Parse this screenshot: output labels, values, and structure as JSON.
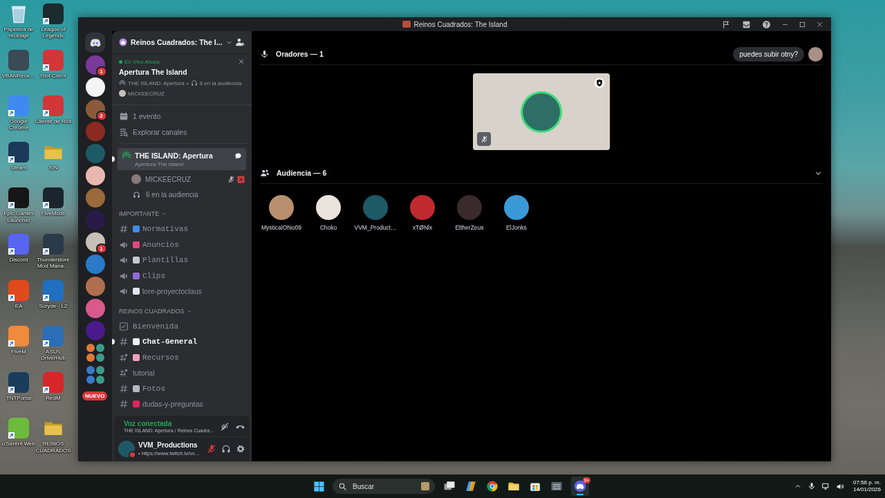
{
  "desktop": {
    "icons": [
      {
        "label": "Papelera de reciclaje",
        "kind": "bin",
        "color": "#a9cfe0",
        "shortcut": false
      },
      {
        "label": "League of Legends",
        "kind": "app",
        "color": "#1b2b2f",
        "shortcut": true
      },
      {
        "label": "VBANRece…",
        "kind": "app",
        "color": "#3b4a55",
        "shortcut": false
      },
      {
        "label": "Riot Client",
        "kind": "app",
        "color": "#d13639",
        "shortcut": true
      },
      {
        "label": "Google Chrome",
        "kind": "app",
        "color": "#3f8af0",
        "shortcut": true
      },
      {
        "label": "Cliente de Riot",
        "kind": "app",
        "color": "#d13639",
        "shortcut": true
      },
      {
        "label": "Steam",
        "kind": "app",
        "color": "#1b3a5a",
        "shortcut": true
      },
      {
        "label": "XIN",
        "kind": "folder",
        "color": "#e8c24a",
        "shortcut": false
      },
      {
        "label": "Epic Games Launcher",
        "kind": "app",
        "color": "#161616",
        "shortcut": true
      },
      {
        "label": "FiveMods",
        "kind": "app",
        "color": "#1c2430",
        "shortcut": true
      },
      {
        "label": "Discord",
        "kind": "app",
        "color": "#5865f2",
        "shortcut": true
      },
      {
        "label": "Thunderstore Mod Mana…",
        "kind": "app",
        "color": "#2b3a4a",
        "shortcut": true
      },
      {
        "label": "EA",
        "kind": "app",
        "color": "#e04a1c",
        "shortcut": true
      },
      {
        "label": "Scryde - L2",
        "kind": "app",
        "color": "#1f6fc2",
        "shortcut": true
      },
      {
        "label": "FiveM",
        "kind": "app",
        "color": "#f08a3c",
        "shortcut": true
      },
      {
        "label": "ASUS DriverHub",
        "kind": "app",
        "color": "#2a6fb5",
        "shortcut": true
      },
      {
        "label": "TNTPortal",
        "kind": "app",
        "color": "#1a3d5c",
        "shortcut": true
      },
      {
        "label": "RedM",
        "kind": "app",
        "color": "#d6262a",
        "shortcut": true
      },
      {
        "label": "uTorrent Web",
        "kind": "app",
        "color": "#6dbb3d",
        "shortcut": true
      },
      {
        "label": "REINOS CUADRADOS",
        "kind": "folder",
        "color": "#e8c24a",
        "shortcut": false
      }
    ]
  },
  "window": {
    "title": "Reinos Cuadrados: The Island"
  },
  "servers": [
    {
      "kind": "server",
      "color": "#7a3a9a",
      "badge": "1"
    },
    {
      "kind": "server",
      "color": "#f4f4f4"
    },
    {
      "kind": "server",
      "color": "#8a5a3a",
      "badge": "2"
    },
    {
      "kind": "server",
      "color": "#8a2a20"
    },
    {
      "kind": "server",
      "color": "#1d5a66"
    },
    {
      "kind": "server",
      "color": "#e8b8b0"
    },
    {
      "kind": "server",
      "color": "#9a6a3a"
    },
    {
      "kind": "server",
      "color": "#2a1a4a"
    },
    {
      "kind": "server",
      "color": "#c8c0b8",
      "badge": "1"
    },
    {
      "kind": "server",
      "color": "#2a7ac8"
    },
    {
      "kind": "server",
      "color": "#b07050"
    },
    {
      "kind": "server",
      "color": "#d85a8a"
    },
    {
      "kind": "server",
      "color": "#4a1a8a"
    },
    {
      "kind": "folder",
      "color": "#e07a3a"
    },
    {
      "kind": "folder",
      "color": "#3a7ac8"
    }
  ],
  "new_badge": "NUEVO",
  "sidebar": {
    "header": {
      "title": "Reinos Cuadrados: The I..."
    },
    "live": {
      "status": "En Vivo Ahora",
      "title": "Apertura The Island",
      "channel": "THE ISLAND: Apertura",
      "separator": "•",
      "audience": "6 en la audiencia",
      "host": "MICKEECRUZ"
    },
    "links": [
      {
        "label": "1 evento",
        "kind": "events"
      },
      {
        "label": "Explorar canales",
        "kind": "browse"
      }
    ],
    "stage": {
      "name": "THE ISLAND: Apertura",
      "topic": "Apertura The Island",
      "selected": true,
      "unread": true,
      "members": [
        {
          "name": "MICKEECRUZ",
          "muted": true
        }
      ],
      "audience": "6 en la audiencia"
    },
    "categories": [
      {
        "name": "IMPORTANTE",
        "expanded": true,
        "channels": [
          {
            "name": "Normativas",
            "kind": "text",
            "color": "#3b8ee8",
            "mono": true,
            "unread": false
          },
          {
            "name": "Anuncios",
            "kind": "announcement",
            "color": "#e8457a",
            "mono": true,
            "unread": false
          },
          {
            "name": "Plantillas",
            "kind": "announcement",
            "color": "#c8c8d0",
            "mono": true,
            "unread": false
          },
          {
            "name": "Clips",
            "kind": "announcement",
            "color": "#8e6ad8",
            "mono": true,
            "unread": false
          },
          {
            "name": "lore-proyectoclaus",
            "kind": "announcement",
            "color": "#dfe6f0",
            "mono": false,
            "unread": false
          }
        ]
      },
      {
        "name": "REINOS CUADRADOS",
        "expanded": true,
        "channels": [
          {
            "name": "Bienvenida",
            "kind": "rules",
            "mono": true,
            "unread": false
          },
          {
            "name": "Chat-General",
            "kind": "text",
            "color": "#f0f0f0",
            "mono": true,
            "unread": true
          },
          {
            "name": "Recursos",
            "kind": "threads",
            "color": "#f0a0b8",
            "mono": true,
            "unread": false
          },
          {
            "name": "tutorial",
            "kind": "threads",
            "mono": false,
            "unread": false
          },
          {
            "name": "Fotos",
            "kind": "text",
            "color": "#b8b8c0",
            "mono": true,
            "unread": false
          },
          {
            "name": "dudas-y-preguntas",
            "kind": "text",
            "color": "#e0245e",
            "mono": false,
            "unread": false
          }
        ]
      }
    ],
    "voice": {
      "status": "Voz conectada",
      "channel": "THE ISLAND: Apertura / Reinos Cuadra…"
    },
    "user": {
      "name": "VVM_Productions",
      "status": "• https://www.twitch.tv/vv…",
      "muted": true
    }
  },
  "stage_view": {
    "speakers_title": "Oradores — 1",
    "request": "puedes subir otny?",
    "speakers": [
      {
        "muted": true,
        "moderator": true
      }
    ],
    "audience_title": "Audiencia — 6",
    "audience_expanded": true,
    "audience": [
      {
        "name": "MysticalOhio09",
        "color": "#b89070"
      },
      {
        "name": "Choko",
        "color": "#e8e4dc"
      },
      {
        "name": "VVM_Product…",
        "color": "#1d5a66"
      },
      {
        "name": "xTØNlx",
        "color": "#c02a30"
      },
      {
        "name": "EltherZeus",
        "color": "#3a2a2e"
      },
      {
        "name": "ElJonks",
        "color": "#3a9ad8"
      }
    ]
  },
  "taskbar": {
    "search": "Buscar",
    "apps": [
      {
        "kind": "task-view",
        "active": false
      },
      {
        "kind": "copilot",
        "active": false
      },
      {
        "kind": "chrome",
        "active": false
      },
      {
        "kind": "files",
        "active": false
      },
      {
        "kind": "store",
        "active": false
      },
      {
        "kind": "vban",
        "active": false
      },
      {
        "kind": "discord",
        "active": true,
        "badge": "9+"
      }
    ],
    "time": "07:56 p. m.",
    "date": "14/01/2026"
  }
}
